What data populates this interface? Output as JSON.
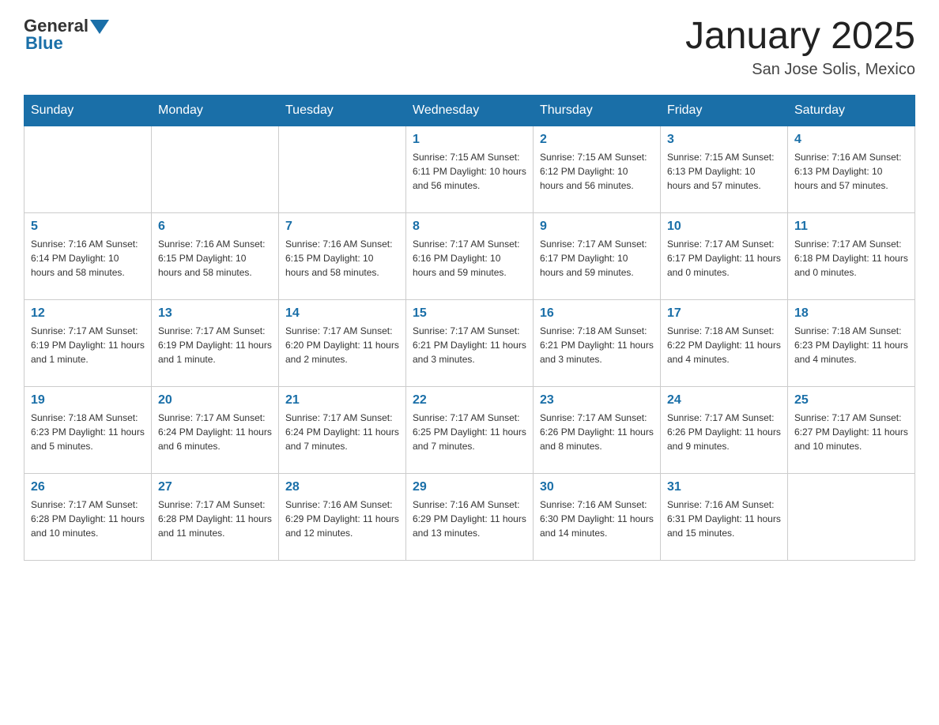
{
  "logo": {
    "text_general": "General",
    "text_blue": "Blue"
  },
  "header": {
    "month_year": "January 2025",
    "location": "San Jose Solis, Mexico"
  },
  "days_of_week": [
    "Sunday",
    "Monday",
    "Tuesday",
    "Wednesday",
    "Thursday",
    "Friday",
    "Saturday"
  ],
  "weeks": [
    [
      {
        "day": "",
        "info": ""
      },
      {
        "day": "",
        "info": ""
      },
      {
        "day": "",
        "info": ""
      },
      {
        "day": "1",
        "info": "Sunrise: 7:15 AM\nSunset: 6:11 PM\nDaylight: 10 hours and 56 minutes."
      },
      {
        "day": "2",
        "info": "Sunrise: 7:15 AM\nSunset: 6:12 PM\nDaylight: 10 hours and 56 minutes."
      },
      {
        "day": "3",
        "info": "Sunrise: 7:15 AM\nSunset: 6:13 PM\nDaylight: 10 hours and 57 minutes."
      },
      {
        "day": "4",
        "info": "Sunrise: 7:16 AM\nSunset: 6:13 PM\nDaylight: 10 hours and 57 minutes."
      }
    ],
    [
      {
        "day": "5",
        "info": "Sunrise: 7:16 AM\nSunset: 6:14 PM\nDaylight: 10 hours and 58 minutes."
      },
      {
        "day": "6",
        "info": "Sunrise: 7:16 AM\nSunset: 6:15 PM\nDaylight: 10 hours and 58 minutes."
      },
      {
        "day": "7",
        "info": "Sunrise: 7:16 AM\nSunset: 6:15 PM\nDaylight: 10 hours and 58 minutes."
      },
      {
        "day": "8",
        "info": "Sunrise: 7:17 AM\nSunset: 6:16 PM\nDaylight: 10 hours and 59 minutes."
      },
      {
        "day": "9",
        "info": "Sunrise: 7:17 AM\nSunset: 6:17 PM\nDaylight: 10 hours and 59 minutes."
      },
      {
        "day": "10",
        "info": "Sunrise: 7:17 AM\nSunset: 6:17 PM\nDaylight: 11 hours and 0 minutes."
      },
      {
        "day": "11",
        "info": "Sunrise: 7:17 AM\nSunset: 6:18 PM\nDaylight: 11 hours and 0 minutes."
      }
    ],
    [
      {
        "day": "12",
        "info": "Sunrise: 7:17 AM\nSunset: 6:19 PM\nDaylight: 11 hours and 1 minute."
      },
      {
        "day": "13",
        "info": "Sunrise: 7:17 AM\nSunset: 6:19 PM\nDaylight: 11 hours and 1 minute."
      },
      {
        "day": "14",
        "info": "Sunrise: 7:17 AM\nSunset: 6:20 PM\nDaylight: 11 hours and 2 minutes."
      },
      {
        "day": "15",
        "info": "Sunrise: 7:17 AM\nSunset: 6:21 PM\nDaylight: 11 hours and 3 minutes."
      },
      {
        "day": "16",
        "info": "Sunrise: 7:18 AM\nSunset: 6:21 PM\nDaylight: 11 hours and 3 minutes."
      },
      {
        "day": "17",
        "info": "Sunrise: 7:18 AM\nSunset: 6:22 PM\nDaylight: 11 hours and 4 minutes."
      },
      {
        "day": "18",
        "info": "Sunrise: 7:18 AM\nSunset: 6:23 PM\nDaylight: 11 hours and 4 minutes."
      }
    ],
    [
      {
        "day": "19",
        "info": "Sunrise: 7:18 AM\nSunset: 6:23 PM\nDaylight: 11 hours and 5 minutes."
      },
      {
        "day": "20",
        "info": "Sunrise: 7:17 AM\nSunset: 6:24 PM\nDaylight: 11 hours and 6 minutes."
      },
      {
        "day": "21",
        "info": "Sunrise: 7:17 AM\nSunset: 6:24 PM\nDaylight: 11 hours and 7 minutes."
      },
      {
        "day": "22",
        "info": "Sunrise: 7:17 AM\nSunset: 6:25 PM\nDaylight: 11 hours and 7 minutes."
      },
      {
        "day": "23",
        "info": "Sunrise: 7:17 AM\nSunset: 6:26 PM\nDaylight: 11 hours and 8 minutes."
      },
      {
        "day": "24",
        "info": "Sunrise: 7:17 AM\nSunset: 6:26 PM\nDaylight: 11 hours and 9 minutes."
      },
      {
        "day": "25",
        "info": "Sunrise: 7:17 AM\nSunset: 6:27 PM\nDaylight: 11 hours and 10 minutes."
      }
    ],
    [
      {
        "day": "26",
        "info": "Sunrise: 7:17 AM\nSunset: 6:28 PM\nDaylight: 11 hours and 10 minutes."
      },
      {
        "day": "27",
        "info": "Sunrise: 7:17 AM\nSunset: 6:28 PM\nDaylight: 11 hours and 11 minutes."
      },
      {
        "day": "28",
        "info": "Sunrise: 7:16 AM\nSunset: 6:29 PM\nDaylight: 11 hours and 12 minutes."
      },
      {
        "day": "29",
        "info": "Sunrise: 7:16 AM\nSunset: 6:29 PM\nDaylight: 11 hours and 13 minutes."
      },
      {
        "day": "30",
        "info": "Sunrise: 7:16 AM\nSunset: 6:30 PM\nDaylight: 11 hours and 14 minutes."
      },
      {
        "day": "31",
        "info": "Sunrise: 7:16 AM\nSunset: 6:31 PM\nDaylight: 11 hours and 15 minutes."
      },
      {
        "day": "",
        "info": ""
      }
    ]
  ]
}
